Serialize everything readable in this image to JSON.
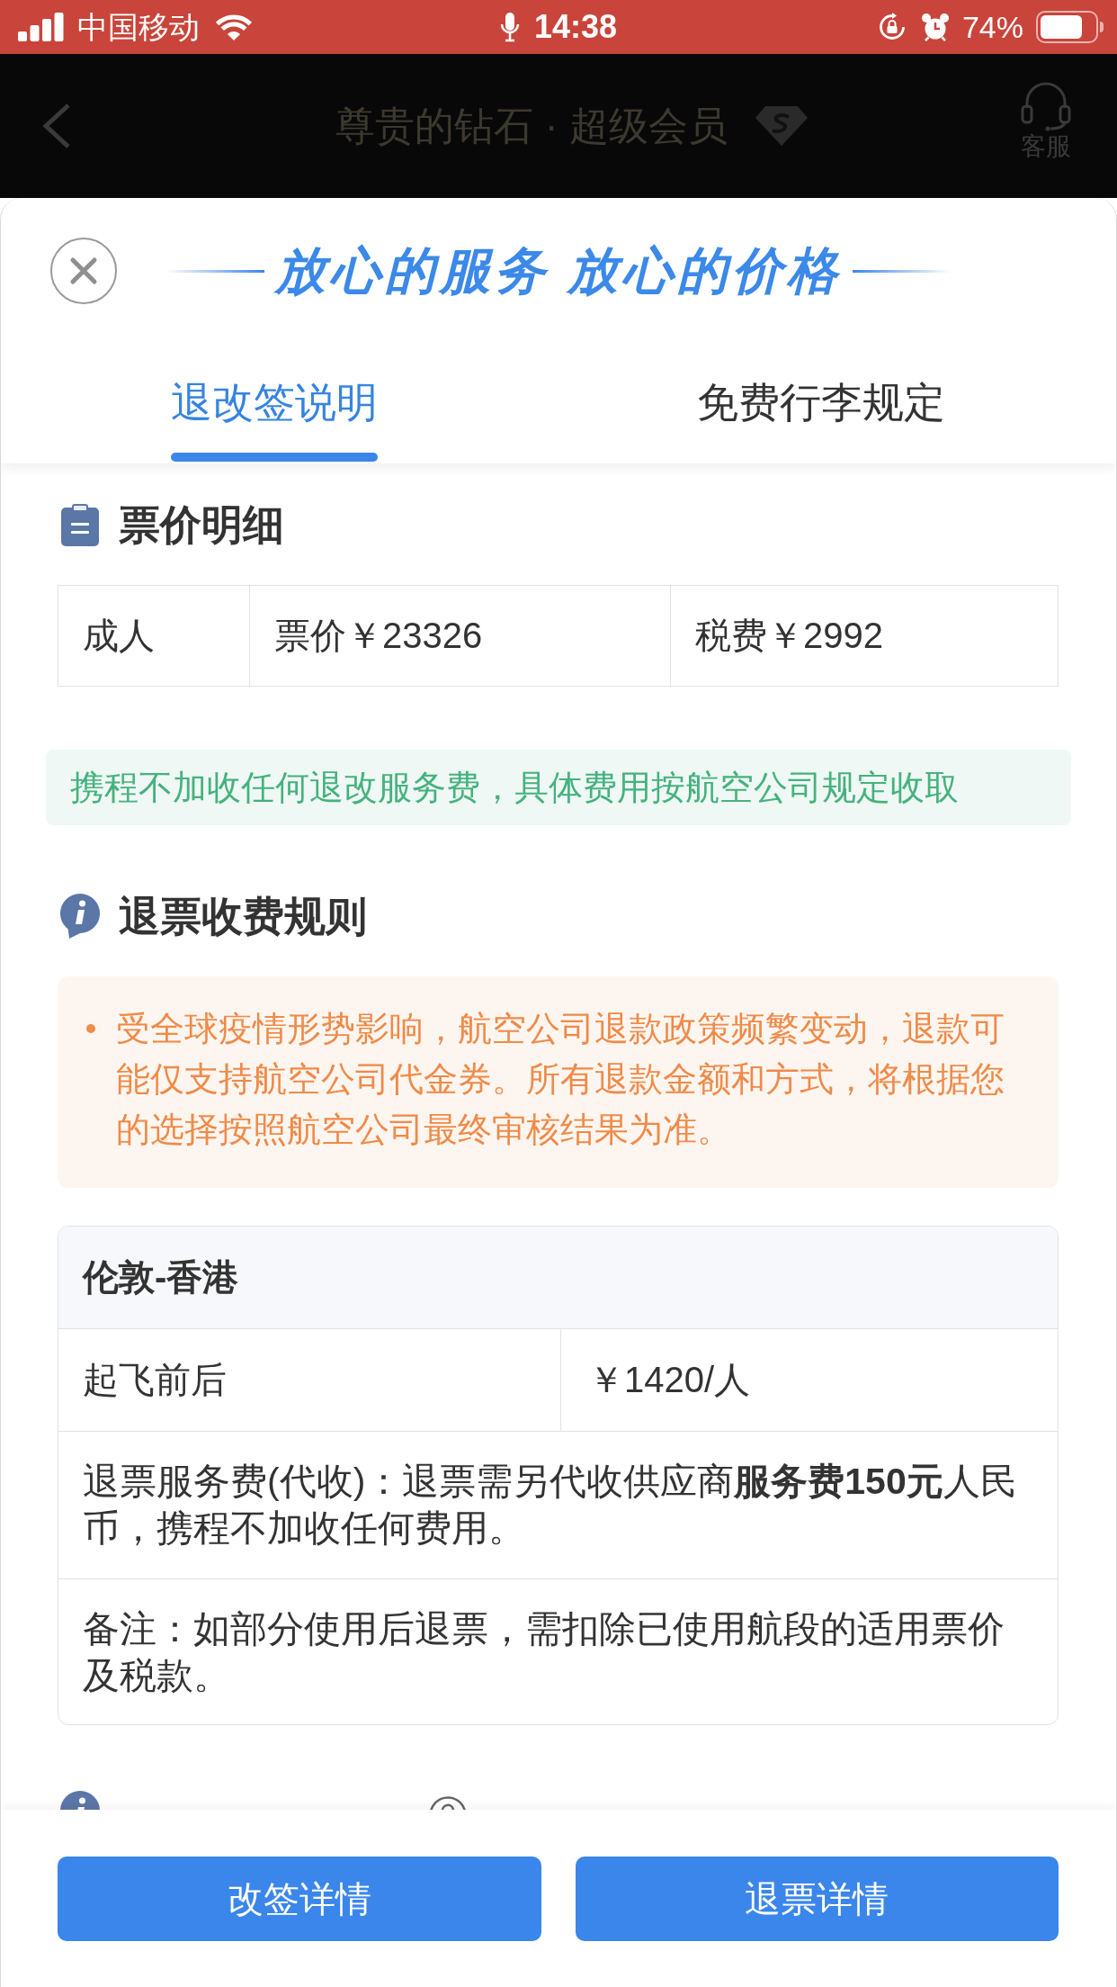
{
  "status_bar": {
    "carrier": "中国移动",
    "time": "14:38",
    "battery": "74%"
  },
  "header": {
    "title": "尊贵的钻石 · 超级会员",
    "service_label": "客服"
  },
  "sheet": {
    "headline": "放心的服务 放心的价格",
    "tabs": [
      {
        "label": "退改签说明",
        "selected": true
      },
      {
        "label": "免费行李规定",
        "selected": false
      }
    ]
  },
  "fare_details": {
    "title": "票价明细",
    "cells": [
      "成人",
      "票价￥23326",
      "税费￥2992"
    ]
  },
  "service_notice": "携程不加收任何退改服务费，具体费用按航空公司规定收取",
  "refund_rules": {
    "title": "退票收费规则",
    "notices": [
      "受全球疫情形势影响，航空公司退款政策频繁变动，退款可能仅支持航空公司代金券。所有退款金额和方式，将根据您的选择按照航空公司最终审核结果为准。"
    ],
    "route": {
      "name": "伦敦-香港",
      "rows": [
        {
          "kind": "pair",
          "cells": [
            "起飞前后",
            "￥1420/人"
          ]
        },
        {
          "kind": "note",
          "text": "退票服务费(代收)：退票需另代收供应商**服务费150元**人民币，携程不加收任何费用。"
        },
        {
          "kind": "note",
          "text": "备注：如部分使用后退票，需扣除已使用航段的适用票价及税款。"
        }
      ]
    }
  },
  "buttons": [
    {
      "label": "改签详情"
    },
    {
      "label": "退票详情"
    }
  ]
}
